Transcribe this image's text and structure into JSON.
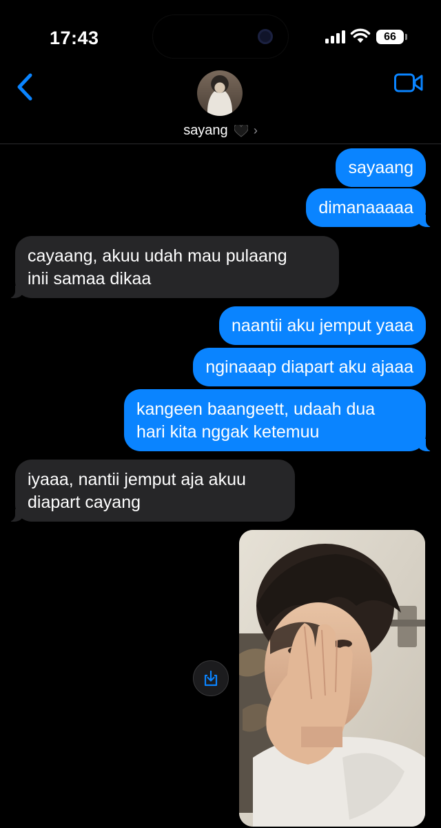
{
  "status_bar": {
    "time": "17:43",
    "battery": "66"
  },
  "header": {
    "contact_name": "sayang",
    "heart_emoji": "🖤"
  },
  "messages": [
    {
      "from": "me",
      "text": "sayaang"
    },
    {
      "from": "me",
      "text": "dimanaaaaa"
    },
    {
      "from": "them",
      "lines": [
        "cayaang, akuu udah mau pulaang",
        "inii samaa dikaa"
      ]
    },
    {
      "from": "me",
      "text": "naantii aku jemput yaaa"
    },
    {
      "from": "me",
      "text": "nginaaap diapart aku ajaaa"
    },
    {
      "from": "me",
      "lines": [
        "kangeen baangeett, udaah dua",
        "hari kita nggak ketemuu"
      ]
    },
    {
      "from": "them",
      "lines": [
        "iyaaa, nantii jemput aja akuu",
        "diapart cayang"
      ]
    },
    {
      "from": "them",
      "type": "photo"
    }
  ],
  "colors": {
    "sent_bubble": "#0a84ff",
    "received_bubble": "#262628",
    "accent": "#0a84ff",
    "background": "#000000"
  },
  "icons": [
    "back-chevron-icon",
    "video-call-icon",
    "save-download-icon",
    "black-heart-emoji",
    "wifi-icon",
    "cellular-signal-icon",
    "battery-icon"
  ]
}
